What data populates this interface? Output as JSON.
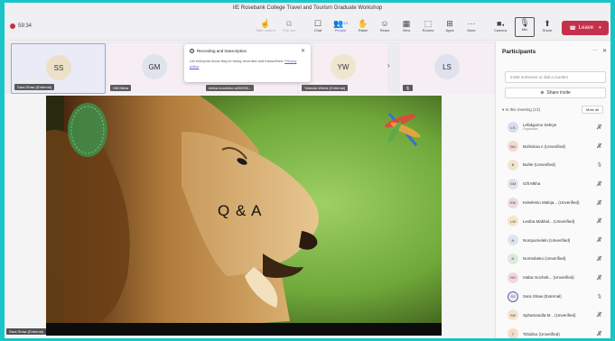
{
  "meeting": {
    "title": "IIE Rosebank College Travel and Tourism Graduate Workshop",
    "timer": "59:34"
  },
  "toolbar": {
    "items": [
      {
        "id": "take-control",
        "label": "Take control",
        "icon": "hand-pointer-icon"
      },
      {
        "id": "pop-out",
        "label": "Pop out",
        "icon": "pop-out-icon"
      },
      {
        "id": "chat",
        "label": "Chat",
        "icon": "chat-icon"
      },
      {
        "id": "people",
        "label": "People",
        "icon": "people-icon",
        "badge": "13"
      },
      {
        "id": "raise",
        "label": "Raise",
        "icon": "raise-hand-icon"
      },
      {
        "id": "react",
        "label": "React",
        "icon": "smiley-icon"
      },
      {
        "id": "view",
        "label": "View",
        "icon": "grid-icon"
      },
      {
        "id": "rooms",
        "label": "Rooms",
        "icon": "rooms-icon"
      },
      {
        "id": "apps",
        "label": "Apps",
        "icon": "apps-plus-icon"
      },
      {
        "id": "more",
        "label": "More",
        "icon": "more-icon"
      },
      {
        "id": "camera",
        "label": "Camera",
        "icon": "camera-icon"
      },
      {
        "id": "mic",
        "label": "Mic",
        "icon": "microphone-icon"
      },
      {
        "id": "share",
        "label": "Share",
        "icon": "share-screen-icon"
      }
    ],
    "leave_label": "Leave"
  },
  "tiles": [
    {
      "initials": "SS",
      "name": "Sara Shaw (External)"
    },
    {
      "initials": "GM",
      "name": "Gift Mkha"
    },
    {
      "initials": "",
      "name": "nteba mocheko a200053..."
    },
    {
      "initials": "YW",
      "name": "Yolanda Wiebe (External)"
    },
    {
      "initials": "LS",
      "name": ""
    }
  ],
  "notification": {
    "title": "Recording and transcription",
    "body": "Let everyone know they're being recorded and transcribed.",
    "link": "Privacy policy"
  },
  "stage": {
    "overlay_text": "Q & A",
    "presenter_tag": "Sara Shaw (External)"
  },
  "participants": {
    "title": "Participants",
    "invite_placeholder": "Invite someone or dial a number",
    "share_invite_label": "Share invite",
    "section_label": "In this meeting (13)",
    "mute_all_label": "Mute all",
    "list": [
      {
        "initials": "LS",
        "name": "Lefakgomo Seleye",
        "role": "Organizer",
        "color": "#d8dcef",
        "mic": "muted"
      },
      {
        "initials": "BN",
        "name": "Bohlokoa n (Unverified)",
        "role": "",
        "color": "#f3d9d3",
        "mic": "muted"
      },
      {
        "initials": "B",
        "name": "Buhle (Unverified)",
        "role": "",
        "color": "#f0e6d0",
        "mic": "on"
      },
      {
        "initials": "GM",
        "name": "Gift Mkha",
        "role": "",
        "color": "#dfe3ec",
        "mic": "muted"
      },
      {
        "initials": "KM",
        "name": "Kekeletso Maleja... (Unverified)",
        "role": "",
        "color": "#ecd9e6",
        "mic": "muted"
      },
      {
        "initials": "LM",
        "name": "Lesiba Makhal... (Unverified)",
        "role": "",
        "color": "#f4e7c6",
        "mic": "muted"
      },
      {
        "initials": "N",
        "name": "Nompumelelo (Unverified)",
        "role": "",
        "color": "#dde6ee",
        "mic": "muted"
      },
      {
        "initials": "N",
        "name": "Nomtobeko (Unverified)",
        "role": "",
        "color": "#dde9dc",
        "mic": "muted"
      },
      {
        "initials": "NS",
        "name": "ntaba mocheb... (Unverified)",
        "role": "",
        "color": "#f2d7dc",
        "mic": "muted"
      },
      {
        "initials": "SS",
        "name": "Sara Shaw (External)",
        "role": "",
        "color": "#e9ebf6",
        "mic": "on",
        "ring": true
      },
      {
        "initials": "SM",
        "name": "Sphamandla M... (Unverified)",
        "role": "",
        "color": "#f3e4cc",
        "mic": "muted"
      },
      {
        "initials": "T",
        "name": "Tshidiso (Unverified)",
        "role": "",
        "color": "#f4dcc9",
        "mic": "muted"
      }
    ]
  }
}
